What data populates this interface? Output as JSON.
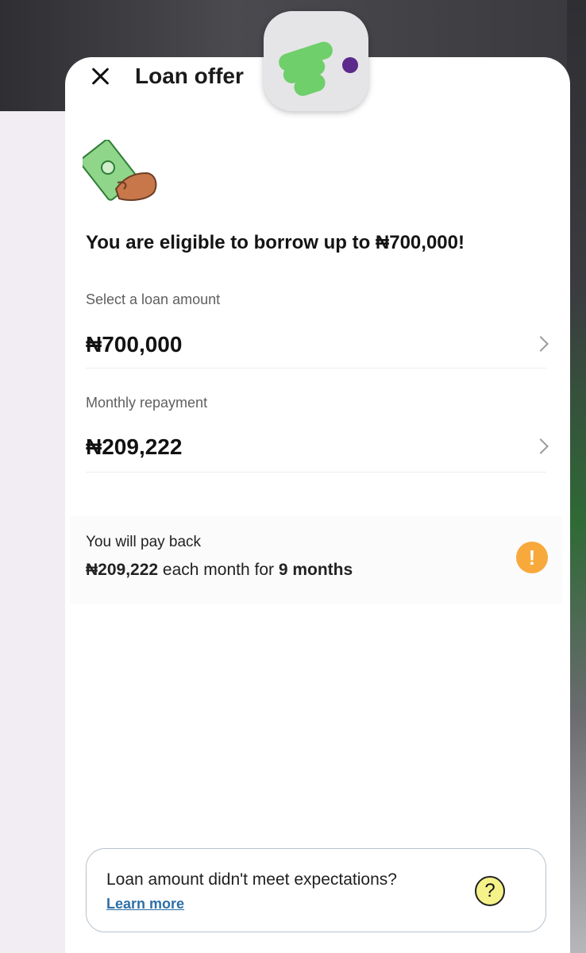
{
  "header": {
    "title": "Loan offer",
    "close_icon": "close-icon",
    "app_logo": "app-logo-icon"
  },
  "offer": {
    "illustration": "money-hand-icon",
    "eligibility_message": "You are eligible to borrow up to ₦700,000!"
  },
  "loan_amount": {
    "label": "Select a loan amount",
    "value": "₦700,000"
  },
  "monthly_repayment": {
    "label": "Monthly repayment",
    "value": "₦209,222"
  },
  "payback": {
    "label": "You will pay back",
    "amount": "₦209,222",
    "middle_text": " each month for ",
    "duration": "9 months",
    "icon": "warning-icon"
  },
  "help": {
    "question": "Loan amount didn't meet expectations?",
    "link_label": "Learn more",
    "icon": "question-icon"
  },
  "colors": {
    "brand_green": "#6fcf6a",
    "brand_purple": "#5b2a8a",
    "warning_orange": "#f7a93b",
    "link_blue": "#2e6fa8"
  }
}
